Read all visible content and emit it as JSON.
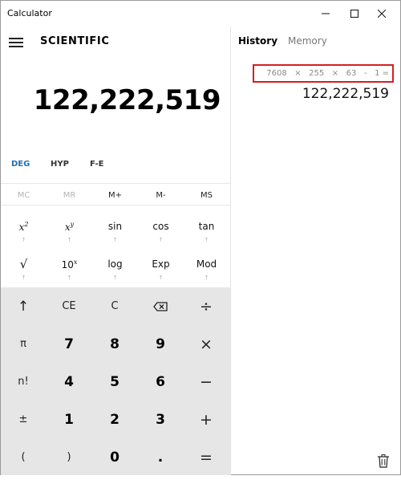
{
  "window": {
    "title": "Calculator"
  },
  "header": {
    "mode_title": "SCIENTIFIC"
  },
  "display": {
    "value": "122,222,519"
  },
  "angle_modes": [
    {
      "label": "DEG",
      "active": true
    },
    {
      "label": "HYP",
      "active": false
    },
    {
      "label": "F-E",
      "active": false
    }
  ],
  "memory": [
    {
      "label": "MC",
      "enabled": false
    },
    {
      "label": "MR",
      "enabled": false
    },
    {
      "label": "M+",
      "enabled": true
    },
    {
      "label": "M-",
      "enabled": true
    },
    {
      "label": "MS",
      "enabled": true
    }
  ],
  "functions_row1": {
    "square_base": "x",
    "square_exp": "2",
    "power_base": "x",
    "power_exp": "y",
    "sin": "sin",
    "cos": "cos",
    "tan": "tan"
  },
  "functions_row2": {
    "sqrt": "√",
    "tenpow_base": "10",
    "tenpow_exp": "x",
    "log": "log",
    "exp": "Exp",
    "mod": "Mod"
  },
  "keypad": {
    "up": "↑",
    "ce": "CE",
    "c": "C",
    "divide": "÷",
    "pi": "π",
    "n7": "7",
    "n8": "8",
    "n9": "9",
    "multiply": "×",
    "factorial": "n!",
    "n4": "4",
    "n5": "5",
    "n6": "6",
    "minus": "−",
    "negate": "±",
    "n1": "1",
    "n2": "2",
    "n3": "3",
    "plus": "+",
    "lparen": "(",
    "rparen": ")",
    "n0": "0",
    "decimal": ".",
    "equals": "="
  },
  "history_panel": {
    "tabs": [
      "History",
      "Memory"
    ],
    "entry": {
      "expression": "7608   ×   255   ×   63   -   1 =",
      "result": "122,222,519"
    }
  },
  "colors": {
    "accent": "#1e6fb3",
    "keypad_bg": "#e6e6e6",
    "highlight_border": "#d42020"
  }
}
